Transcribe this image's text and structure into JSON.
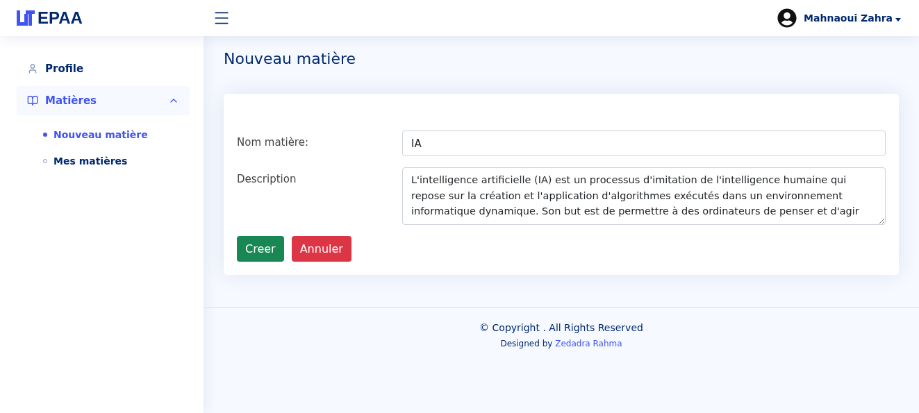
{
  "header": {
    "brand": "EPAA",
    "user": "Mahnaoui Zahra"
  },
  "sidebar": {
    "items": [
      {
        "kind": "link",
        "label": "Profile",
        "selected": false
      },
      {
        "kind": "group",
        "label": "Matières",
        "selected": true,
        "expanded": true,
        "children": [
          {
            "label": "Nouveau matière",
            "selected": true
          },
          {
            "label": "Mes matières",
            "selected": false
          }
        ]
      }
    ]
  },
  "page_title": "Nouveau matière",
  "form": {
    "fields": [
      {
        "kind": "input",
        "label": "Nom matière:",
        "value": "IA"
      },
      {
        "kind": "textarea",
        "label": "Description",
        "value": "L'intelligence artificielle (IA) est un processus d'imitation de l'intelligence humaine qui repose sur la création et l'application d'algorithmes exécutés dans un environnement informatique dynamique. Son but est de permettre à des ordinateurs de penser et d'agir"
      }
    ],
    "buttons": [
      {
        "kind": "success",
        "label": "Creer"
      },
      {
        "kind": "danger",
        "label": "Annuler"
      }
    ]
  },
  "footer": {
    "copyright": "© Copyright . All Rights Reserved",
    "designed_by": "Designed by",
    "designer": "Zedadra Rahma"
  }
}
